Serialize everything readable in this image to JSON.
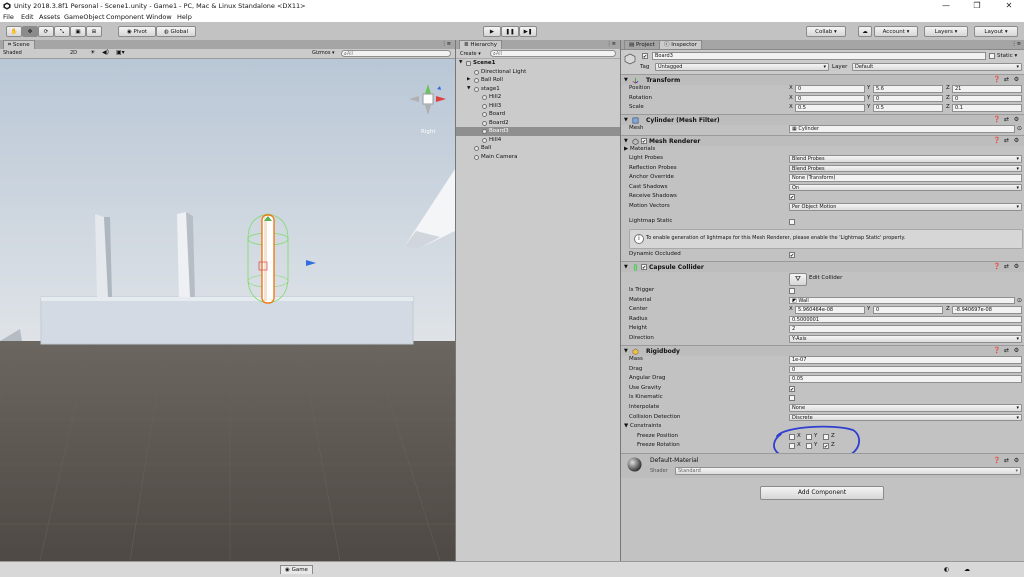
{
  "window": {
    "title": "Unity 2018.3.8f1 Personal - Scene1.unity - Game1 - PC, Mac & Linux Standalone <DX11>",
    "controls": [
      "—",
      "❐",
      "✕"
    ]
  },
  "menu": [
    "File",
    "Edit",
    "Assets",
    "GameObject",
    "Component",
    "Window",
    "Help"
  ],
  "toolbar": {
    "pivot_label": "Pivot",
    "global_label": "Global",
    "collab_label": "Collab ▾",
    "account_label": "Account ▾",
    "layers_label": "Layers",
    "layout_label": "Layout"
  },
  "scene": {
    "tab_label": "Scene",
    "shading_mode": "Shaded",
    "mode_2d": "2D",
    "gizmos_label": "Gizmos ▾",
    "search_placeholder": "All",
    "gizmo_view_label": "Right"
  },
  "hierarchy": {
    "tab_label": "Hierarchy",
    "create_label": "Create ▾",
    "search_placeholder": "All",
    "items": [
      {
        "label": "Scene1",
        "depth": 0,
        "bold": true,
        "arrow": "▼"
      },
      {
        "label": "Directional Light",
        "depth": 1,
        "arrow": ""
      },
      {
        "label": "Ball Roll",
        "depth": 1,
        "arrow": "▶"
      },
      {
        "label": "stage1",
        "depth": 1,
        "arrow": "▼"
      },
      {
        "label": "Hill2",
        "depth": 2,
        "arrow": ""
      },
      {
        "label": "Hill3",
        "depth": 2,
        "arrow": ""
      },
      {
        "label": "Board",
        "depth": 2,
        "arrow": ""
      },
      {
        "label": "Board2",
        "depth": 2,
        "arrow": ""
      },
      {
        "label": "Board3",
        "depth": 2,
        "arrow": "",
        "selected": true
      },
      {
        "label": "Hill4",
        "depth": 2,
        "arrow": ""
      },
      {
        "label": "Ball",
        "depth": 1,
        "arrow": ""
      },
      {
        "label": "Main Camera",
        "depth": 1,
        "arrow": ""
      }
    ]
  },
  "inspector": {
    "tabs": [
      "Project",
      "Inspector"
    ],
    "object_name": "Board3",
    "static_label": "Static ▾",
    "tag_label": "Tag",
    "tag_value": "Untagged",
    "layer_label": "Layer",
    "layer_value": "Default",
    "transform": {
      "title": "Transform",
      "rows": [
        {
          "label": "Position",
          "x": "0",
          "y": "5.6",
          "z": "21"
        },
        {
          "label": "Rotation",
          "x": "0",
          "y": "0",
          "z": "0"
        },
        {
          "label": "Scale",
          "x": "0.5",
          "y": "0.5",
          "z": "0.1"
        }
      ]
    },
    "mesh_filter": {
      "title": "Cylinder (Mesh Filter)",
      "mesh_label": "Mesh",
      "mesh_value": "Cylinder"
    },
    "mesh_renderer": {
      "title": "Mesh Renderer",
      "materials_label": "Materials",
      "rows": [
        {
          "label": "Light Probes",
          "value": "Blend Probes",
          "kind": "drop"
        },
        {
          "label": "Reflection Probes",
          "value": "Blend Probes",
          "kind": "drop"
        },
        {
          "label": "Anchor Override",
          "value": "None (Transform)",
          "kind": "field"
        },
        {
          "label": "Cast Shadows",
          "value": "On",
          "kind": "drop"
        },
        {
          "label": "Receive Shadows",
          "value": "",
          "kind": "check"
        },
        {
          "label": "Motion Vectors",
          "value": "Per Object Motion",
          "kind": "drop"
        }
      ],
      "lightmap_static_label": "Lightmap Static",
      "info_text": "To enable generation of lightmaps for this Mesh Renderer, please enable the 'Lightmap Static' property.",
      "dynamic_occluded_label": "Dynamic Occluded"
    },
    "capsule_collider": {
      "title": "Capsule Collider",
      "edit_collider_label": "Edit Collider",
      "is_trigger_label": "Is Trigger",
      "material_label": "Material",
      "material_value": "Wall",
      "center_label": "Center",
      "center_x": "5.960464e-08",
      "center_y": "0",
      "center_z": "-8.940697e-08",
      "radius_label": "Radius",
      "radius_value": "0.5000001",
      "height_label": "Height",
      "height_value": "2",
      "direction_label": "Direction",
      "direction_value": "Y-Axis"
    },
    "rigidbody": {
      "title": "Rigidbody",
      "mass_label": "Mass",
      "mass_value": "1e-07",
      "drag_label": "Drag",
      "drag_value": "0",
      "angular_drag_label": "Angular Drag",
      "angular_drag_value": "0.05",
      "use_gravity_label": "Use Gravity",
      "is_kinematic_label": "Is Kinematic",
      "interpolate_label": "Interpolate",
      "interpolate_value": "None",
      "collision_label": "Collision Detection",
      "collision_value": "Discrete",
      "constraints_label": "Constraints",
      "freeze_position_label": "Freeze Position",
      "freeze_rotation_label": "Freeze Rotation",
      "axis_labels": [
        "X",
        "Y",
        "Z"
      ],
      "freeze_position": [
        false,
        false,
        false
      ],
      "freeze_rotation": [
        false,
        false,
        true
      ]
    },
    "material": {
      "name": "Default-Material",
      "shader_label": "Shader",
      "shader_value": "Standard"
    },
    "add_component_label": "Add Component"
  },
  "game_tab_label": "Game",
  "colors": {
    "annotation_circle": "#2f3fd0",
    "selection_outline": "#f07a1a",
    "collider_green": "#7cdc6a",
    "ground": "#5b5651"
  }
}
